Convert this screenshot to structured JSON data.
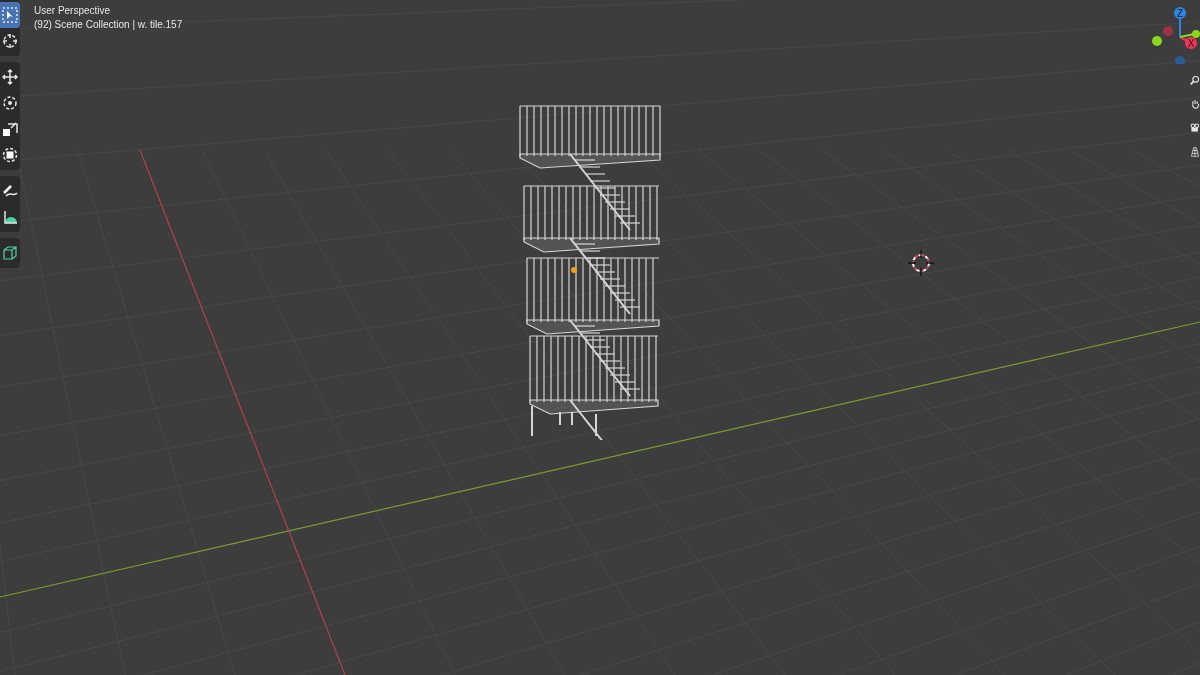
{
  "viewport": {
    "view_name": "User Perspective",
    "collection_info": "(92) Scene Collection | w. tile.157"
  },
  "toolbar": {
    "groups": [
      {
        "tools": [
          {
            "kind": "select",
            "selected": true
          },
          {
            "kind": "cursor",
            "selected": false
          }
        ]
      },
      {
        "tools": [
          {
            "kind": "move",
            "selected": false
          },
          {
            "kind": "rotate",
            "selected": false
          },
          {
            "kind": "scale",
            "selected": false
          },
          {
            "kind": "transform",
            "selected": false
          }
        ]
      },
      {
        "tools": [
          {
            "kind": "annotate",
            "selected": false
          },
          {
            "kind": "measure",
            "selected": false
          }
        ]
      },
      {
        "tools": [
          {
            "kind": "add-cube",
            "selected": false
          }
        ]
      }
    ]
  },
  "gizmo": {
    "axes": [
      {
        "kind": "z",
        "label": "Z",
        "color": "#2f83e3"
      },
      {
        "kind": "x",
        "label": "X",
        "color": "#f5345b"
      },
      {
        "kind": "y",
        "color": "#8ad71b"
      }
    ]
  },
  "navigation": {
    "buttons": [
      {
        "kind": "zoom"
      },
      {
        "kind": "pan"
      },
      {
        "kind": "camera"
      },
      {
        "kind": "perspective"
      }
    ]
  }
}
